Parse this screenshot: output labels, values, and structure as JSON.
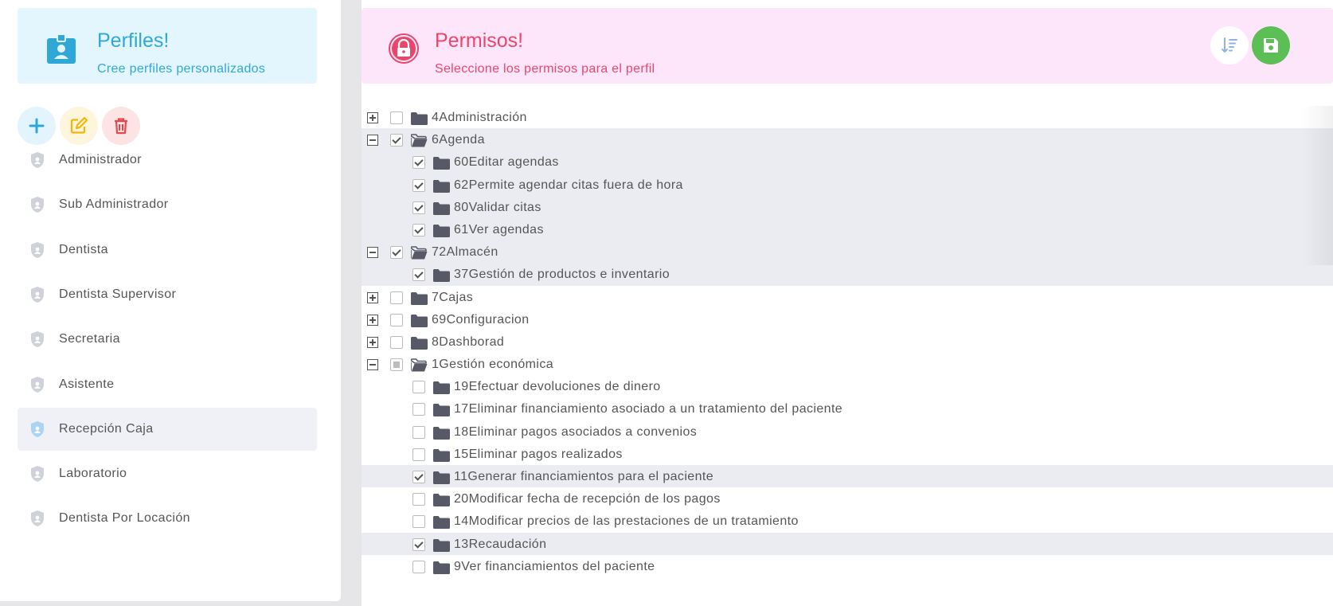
{
  "perfiles": {
    "title": "Perfiles!",
    "subtitle": "Cree perfiles personalizados",
    "icon": "id-badge-icon",
    "accent": "#2fa8d8"
  },
  "actions": {
    "add_icon": "plus-icon",
    "edit_icon": "edit-icon",
    "delete_icon": "trash-icon"
  },
  "profiles": [
    {
      "label": "Administrador",
      "active": false
    },
    {
      "label": "Sub Administrador",
      "active": false
    },
    {
      "label": "Dentista",
      "active": false
    },
    {
      "label": "Dentista Supervisor",
      "active": false
    },
    {
      "label": "Secretaria",
      "active": false
    },
    {
      "label": "Asistente",
      "active": false
    },
    {
      "label": "Recepción Caja",
      "active": true
    },
    {
      "label": "Laboratorio",
      "active": false
    },
    {
      "label": "Dentista Por Locación",
      "active": false
    }
  ],
  "permisos": {
    "title": "Permisos!",
    "subtitle": "Seleccione los permisos para el perfil",
    "icon": "lock-icon",
    "accent": "#e9466b",
    "sort_icon": "sort-icon",
    "save_icon": "save-icon"
  },
  "tree": [
    {
      "label": "4Administración",
      "level": 0,
      "toggle": "plus",
      "check": "off",
      "open": false,
      "selected": false
    },
    {
      "label": "6Agenda",
      "level": 0,
      "toggle": "minus",
      "check": "on",
      "open": true,
      "selected": true
    },
    {
      "label": "60Editar agendas",
      "level": 1,
      "toggle": "",
      "check": "on",
      "open": false,
      "selected": true
    },
    {
      "label": "62Permite agendar citas fuera de hora",
      "level": 1,
      "toggle": "",
      "check": "on",
      "open": false,
      "selected": true
    },
    {
      "label": "80Validar citas",
      "level": 1,
      "toggle": "",
      "check": "on",
      "open": false,
      "selected": true
    },
    {
      "label": "61Ver agendas",
      "level": 1,
      "toggle": "",
      "check": "on",
      "open": false,
      "selected": true
    },
    {
      "label": "72Almacén",
      "level": 0,
      "toggle": "minus",
      "check": "on",
      "open": true,
      "selected": true
    },
    {
      "label": "37Gestión de productos e inventario",
      "level": 1,
      "toggle": "",
      "check": "on",
      "open": false,
      "selected": true
    },
    {
      "label": "7Cajas",
      "level": 0,
      "toggle": "plus",
      "check": "off",
      "open": false,
      "selected": false
    },
    {
      "label": "69Configuracion",
      "level": 0,
      "toggle": "plus",
      "check": "off",
      "open": false,
      "selected": false
    },
    {
      "label": "8Dashborad",
      "level": 0,
      "toggle": "plus",
      "check": "off",
      "open": false,
      "selected": false
    },
    {
      "label": "1Gestión económica",
      "level": 0,
      "toggle": "minus",
      "check": "partial",
      "open": true,
      "selected": false
    },
    {
      "label": "19Efectuar devoluciones de dinero",
      "level": 1,
      "toggle": "",
      "check": "off",
      "open": false,
      "selected": false
    },
    {
      "label": "17Eliminar financiamiento asociado a un tratamiento del paciente",
      "level": 1,
      "toggle": "",
      "check": "off",
      "open": false,
      "selected": false
    },
    {
      "label": "18Eliminar pagos asociados a convenios",
      "level": 1,
      "toggle": "",
      "check": "off",
      "open": false,
      "selected": false
    },
    {
      "label": "15Eliminar pagos realizados",
      "level": 1,
      "toggle": "",
      "check": "off",
      "open": false,
      "selected": false
    },
    {
      "label": "11Generar financiamientos para el paciente",
      "level": 1,
      "toggle": "",
      "check": "on",
      "open": false,
      "selected": true
    },
    {
      "label": "20Modificar fecha de recepción de los pagos",
      "level": 1,
      "toggle": "",
      "check": "off",
      "open": false,
      "selected": false
    },
    {
      "label": "14Modificar precios de las prestaciones de un tratamiento",
      "level": 1,
      "toggle": "",
      "check": "off",
      "open": false,
      "selected": false
    },
    {
      "label": "13Recaudación",
      "level": 1,
      "toggle": "",
      "check": "on",
      "open": false,
      "selected": true
    },
    {
      "label": "9Ver financiamientos del paciente",
      "level": 1,
      "toggle": "",
      "check": "off",
      "open": false,
      "selected": false
    }
  ]
}
